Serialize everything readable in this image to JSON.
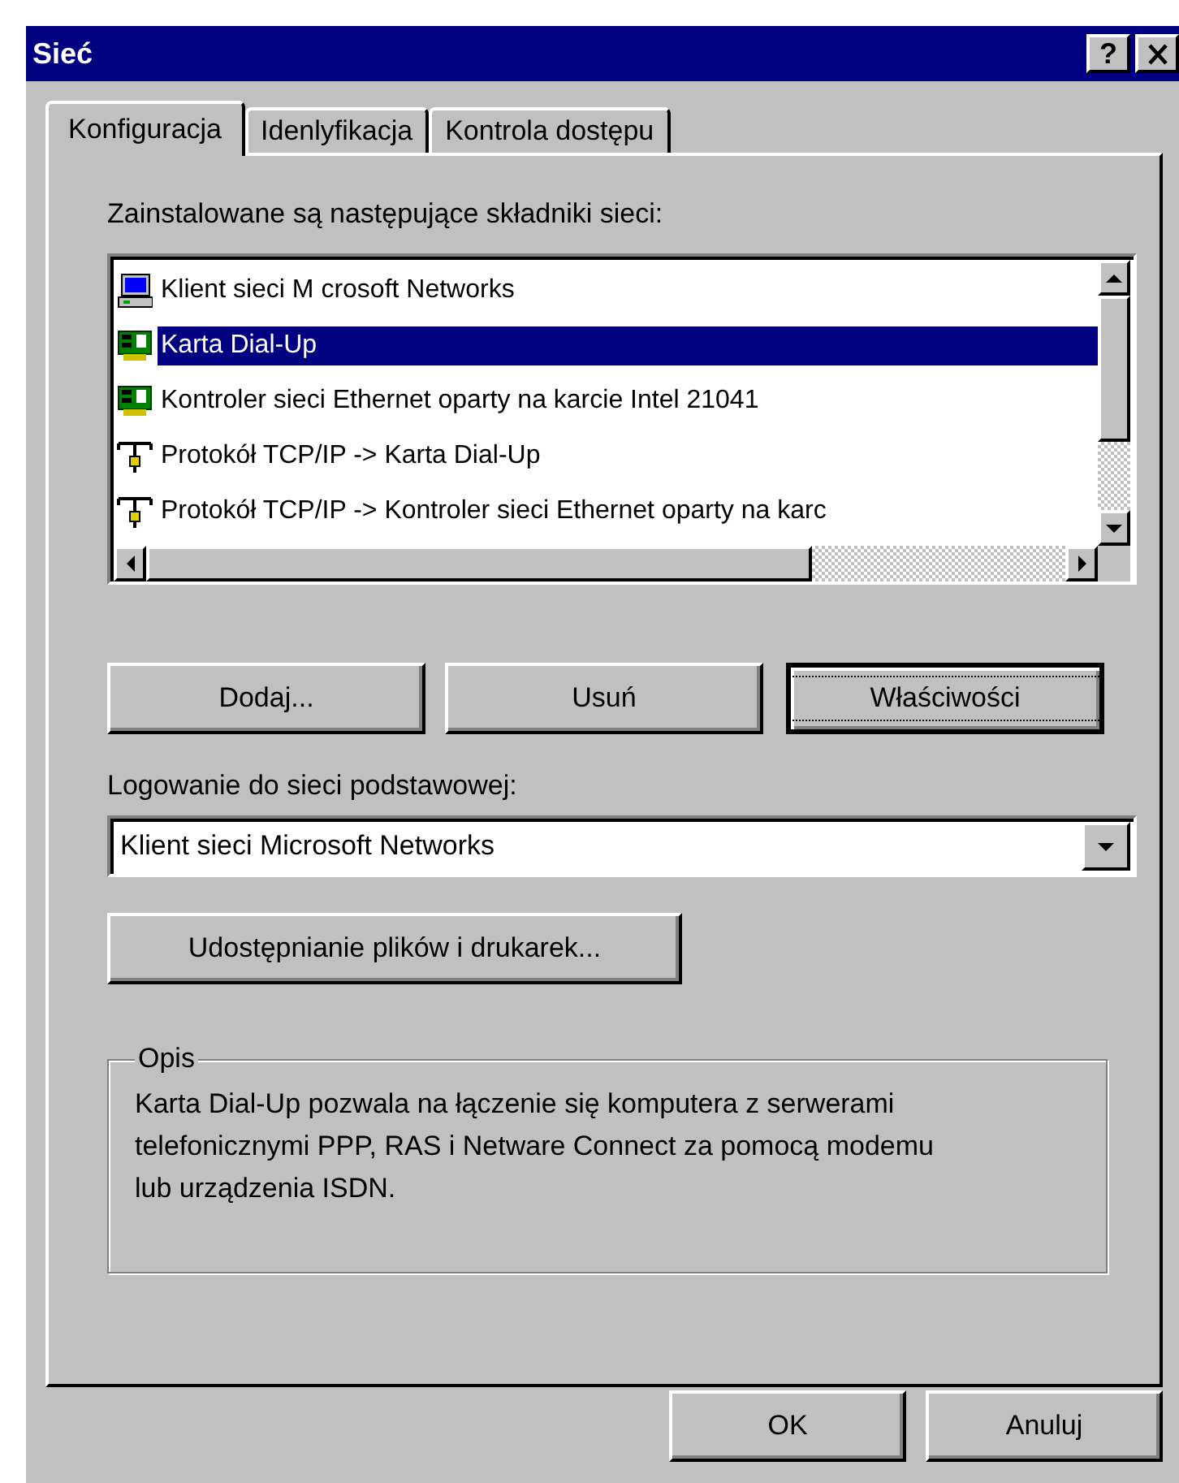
{
  "window": {
    "title": "Sieć",
    "title_buttons": [
      "?"
    ]
  },
  "tabs": [
    {
      "label": "Konfiguracja",
      "selected": true
    },
    {
      "label": "Idenlyfikacja",
      "selected": false
    },
    {
      "label": "Kontrola dostępu",
      "selected": false
    }
  ],
  "components": {
    "label": "Zainstalowane są następujące składniki sieci:",
    "items": [
      {
        "kind": "client",
        "label": "Klient sieci M crosoft Networks",
        "selected": false
      },
      {
        "kind": "adapter",
        "label": "Karta Dial-Up",
        "selected": true
      },
      {
        "kind": "adapter",
        "label": "Kontroler sieci Ethernet oparty na karcie Intel 21041",
        "selected": false
      },
      {
        "kind": "protocol",
        "label": "Protokół TCP/IP -> Karta Dial-Up",
        "selected": false
      },
      {
        "kind": "protocol",
        "label": "Protokół TCP/IP -> Kontroler sieci Ethernet oparty na karc",
        "selected": false
      }
    ]
  },
  "actions": [
    {
      "label": "Dodaj...",
      "focused": false
    },
    {
      "label": "Usuń",
      "focused": false
    },
    {
      "label": "Właściwości",
      "focused": true
    }
  ],
  "logon": {
    "label": "Logowanie do sieci podstawowej:",
    "value": "Klient sieci Microsoft Networks"
  },
  "sharing_button": "Udostępnianie plików i drukarek...",
  "description": {
    "title": "Opis",
    "text": "Karta Dial-Up pozwala na łączenie się komputera z serwerami telefonicznymi PPP, RAS i Netware Connect za pomocą modemu lub urządzenia ISDN."
  },
  "buttons": [
    "OK",
    "Anuluj"
  ]
}
